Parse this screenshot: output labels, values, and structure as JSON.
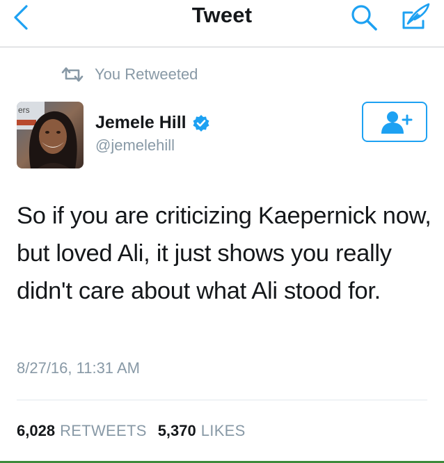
{
  "nav": {
    "title": "Tweet",
    "back_icon": "chevron-left-icon",
    "search_icon": "search-icon",
    "compose_icon": "compose-tweet-icon"
  },
  "retweet_context": {
    "icon": "retweet-icon",
    "label": "You Retweeted"
  },
  "author": {
    "name": "Jemele Hill",
    "handle": "@jemelehill",
    "verified": true,
    "avatar_overlay_text": "ers"
  },
  "follow_button": {
    "icon": "follow-user-icon"
  },
  "tweet": {
    "text": "So if you are criticizing Kaepernick now, but loved Ali, it just shows you really didn't care about what Ali stood for.",
    "timestamp": "8/27/16, 11:31 AM"
  },
  "stats": {
    "retweets_count": "6,028",
    "retweets_label": "RETWEETS",
    "likes_count": "5,370",
    "likes_label": "LIKES"
  },
  "colors": {
    "accent": "#1da1f2",
    "secondary_text": "#8899a6",
    "primary_text": "#14171a",
    "verified_badge": "#1da1f2"
  }
}
